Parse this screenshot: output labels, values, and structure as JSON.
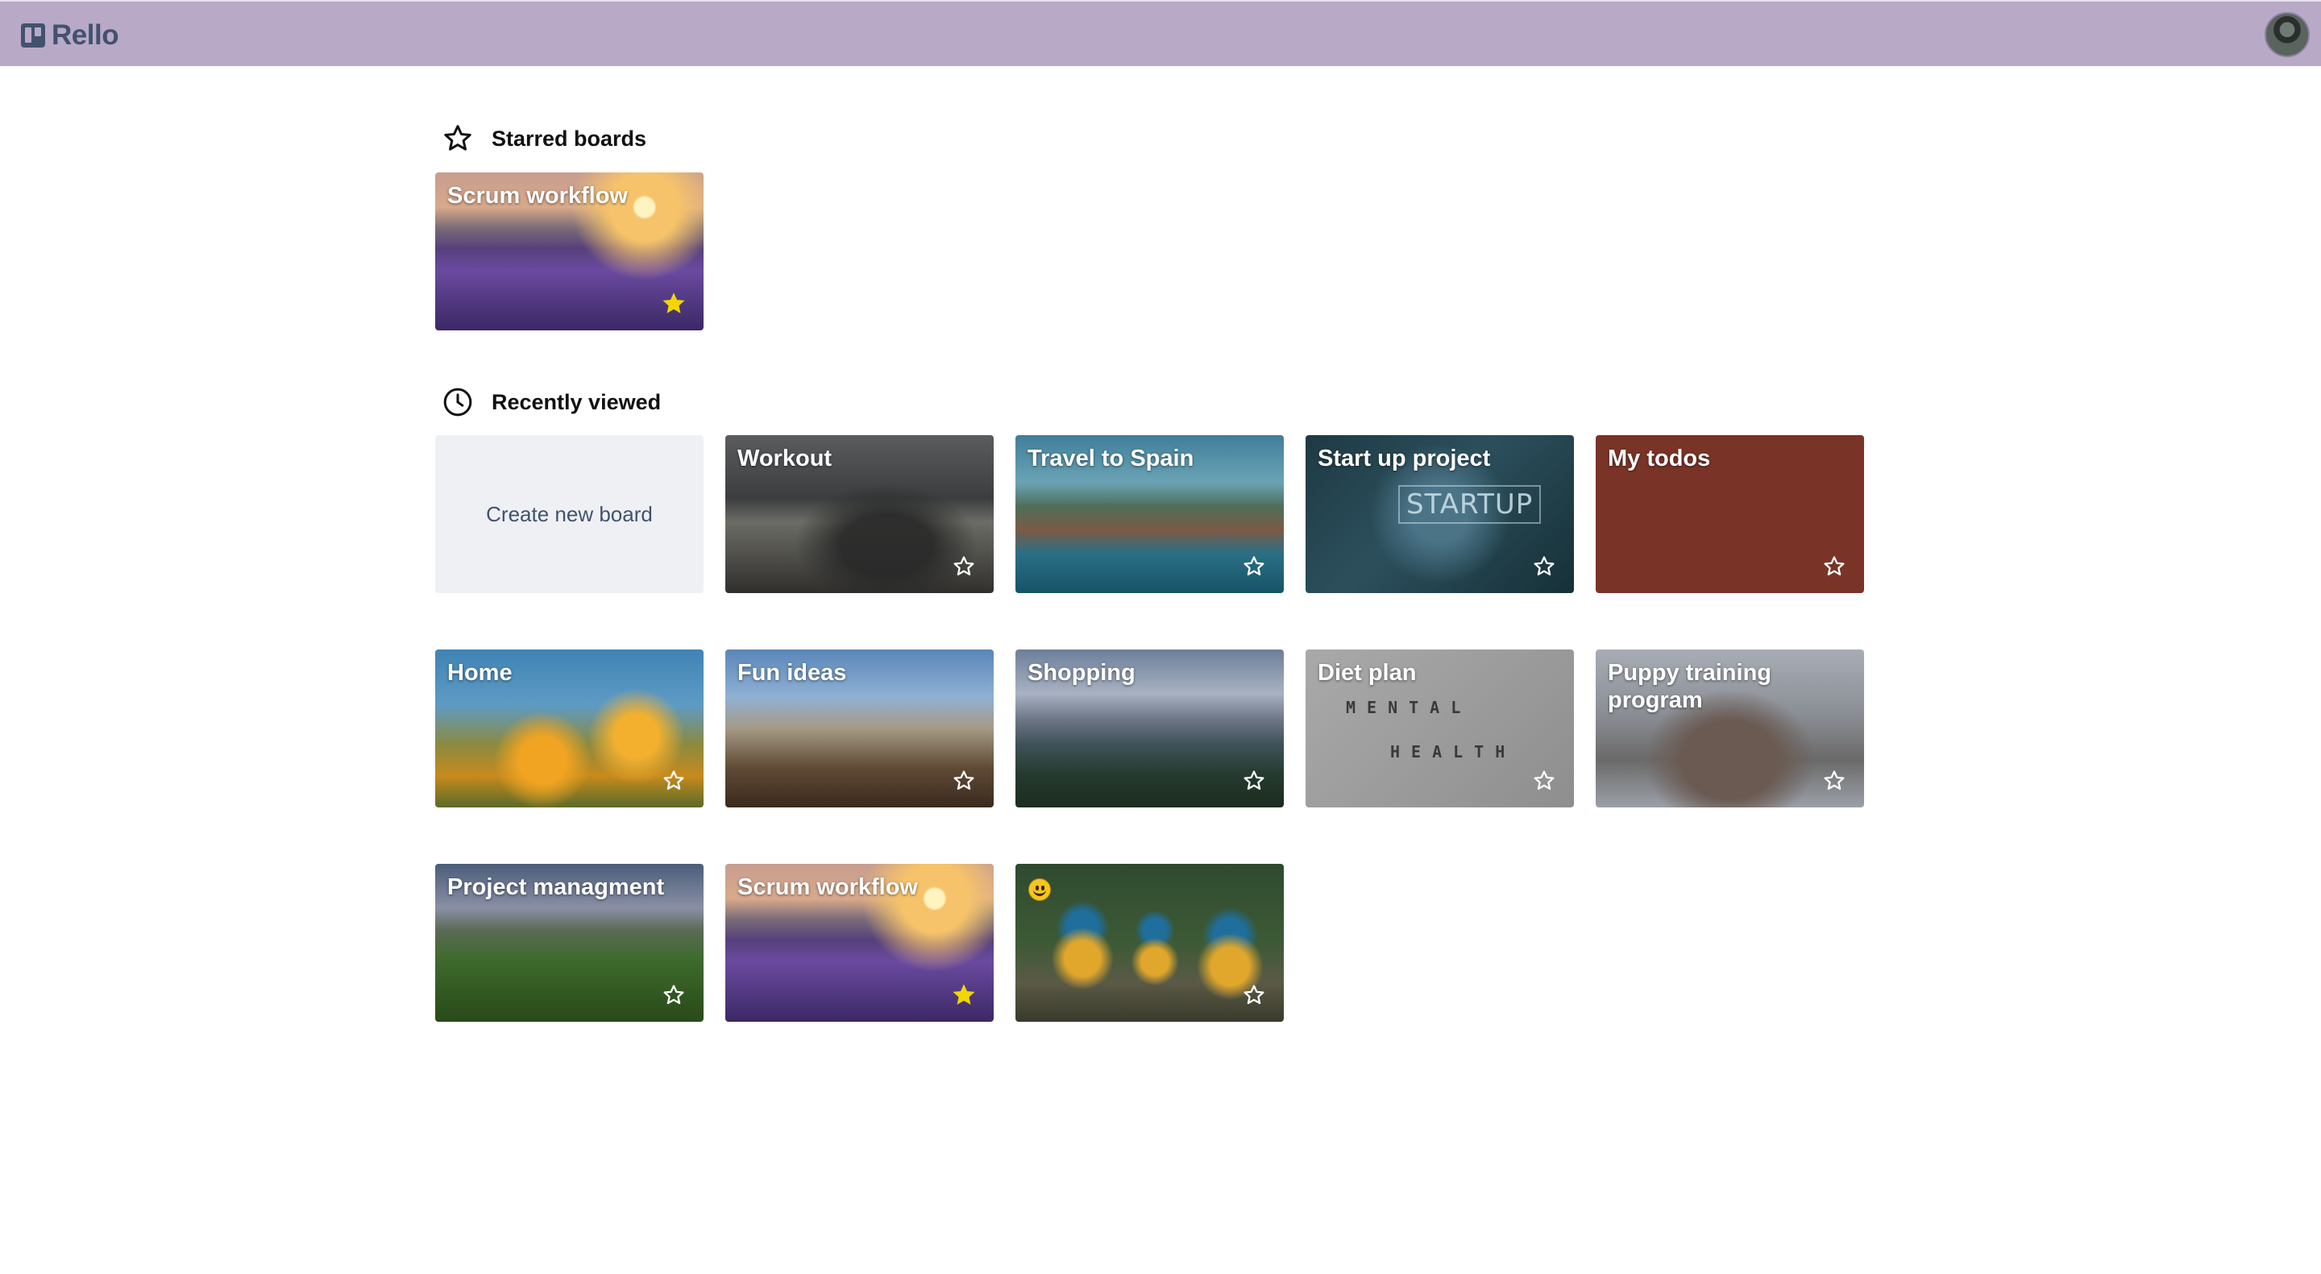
{
  "app": {
    "name": "Rello",
    "avatar_icon": "user-avatar"
  },
  "sections": {
    "starred": {
      "title": "Starred boards",
      "icon": "star-outline-icon",
      "boards": [
        {
          "title": "Scrum workflow",
          "starred": true
        }
      ]
    },
    "recent": {
      "title": "Recently viewed",
      "icon": "clock-icon",
      "create_label": "Create new board",
      "boards": [
        {
          "title": "Workout",
          "starred": false
        },
        {
          "title": "Travel to Spain",
          "starred": false
        },
        {
          "title": "Start up project",
          "starred": false
        },
        {
          "title": "My todos",
          "starred": false
        },
        {
          "title": "Home",
          "starred": false
        },
        {
          "title": "Fun ideas",
          "starred": false
        },
        {
          "title": "Shopping",
          "starred": false
        },
        {
          "title": "Diet plan",
          "starred": false
        },
        {
          "title": "Puppy training program",
          "starred": false
        },
        {
          "title": "Project managment",
          "starred": false
        },
        {
          "title": "Scrum workflow",
          "starred": true
        },
        {
          "title": "",
          "starred": false,
          "emoji": "smiley-emoji"
        }
      ]
    }
  },
  "decor": {
    "startup_text": "STARTUP",
    "mental": "MENTAL",
    "health": "HEALTH"
  },
  "colors": {
    "topbar": "#b8a9c7",
    "star_filled": "#f2d600",
    "my_todos_bg": "#7a3427",
    "create_tile_bg": "#eef0f3"
  }
}
